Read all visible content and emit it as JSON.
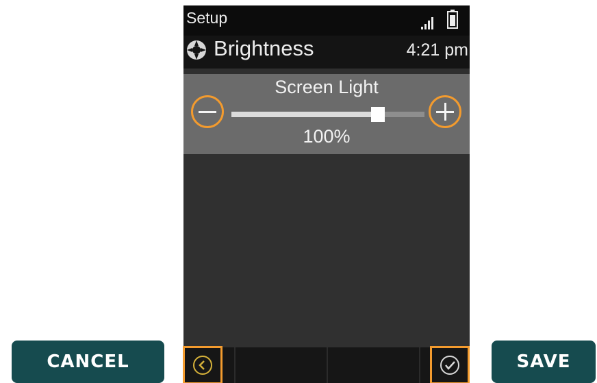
{
  "status_bar": {
    "title": "Setup",
    "signal_icon": "signal-bars-icon",
    "battery_icon": "battery-icon"
  },
  "header": {
    "icon": "settings-icon",
    "title": "Brightness",
    "time": "4:21 pm"
  },
  "screen_light": {
    "label": "Screen Light",
    "value_text": "100%",
    "slider_level": 0.76,
    "decrease_icon": "minus-icon",
    "increase_icon": "plus-icon"
  },
  "soft_keys": {
    "back_icon": "chevron-left-icon",
    "ok_icon": "checkmark-icon"
  },
  "actions": {
    "cancel_label": "CANCEL",
    "save_label": "SAVE"
  },
  "colors": {
    "highlight": "#f39b2e",
    "action_button": "#164b4f",
    "panel": "#6b6b6b",
    "screen_bg": "#2f2f2f"
  }
}
